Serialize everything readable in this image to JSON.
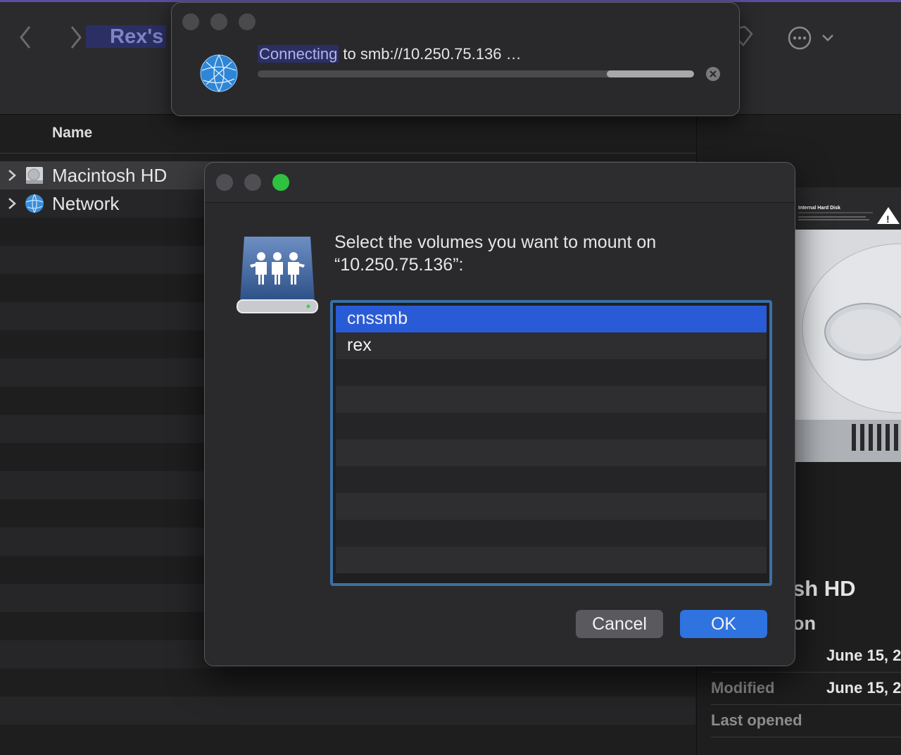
{
  "toolbar": {
    "window_title": "Rex's",
    "back_icon": "chevron-left-icon",
    "forward_icon": "chevron-right-icon",
    "more_icon": "ellipsis-circle-icon",
    "tag_icon": "tag-icon"
  },
  "list": {
    "column_name": "Name",
    "items": [
      {
        "label": "Macintosh HD",
        "icon": "hard-disk-icon"
      },
      {
        "label": "Network",
        "icon": "network-globe-icon"
      }
    ]
  },
  "inspector": {
    "title_fragment": "sh HD",
    "subtitle_fragment": "on",
    "rows": [
      {
        "key": "",
        "value": "June 15, 2"
      },
      {
        "key": "Modified",
        "value": "June 15, 2"
      },
      {
        "key": "Last opened",
        "value": ""
      }
    ],
    "image_label": "Internal Hard Disk"
  },
  "progress": {
    "highlight": "Connecting",
    "text": " to smb://10.250.75.136 …",
    "fraction": 0.2,
    "stop_icon": "stop-circle-icon"
  },
  "mount_dialog": {
    "message_line1": "Select the volumes you want to mount on",
    "message_line2": "“10.250.75.136”:",
    "volumes": [
      "cnssmb",
      "rex"
    ],
    "selected_volume": "cnssmb",
    "cancel_label": "Cancel",
    "ok_label": "OK",
    "accent": "#2f73e0",
    "selection_color": "#2a5bd7"
  }
}
